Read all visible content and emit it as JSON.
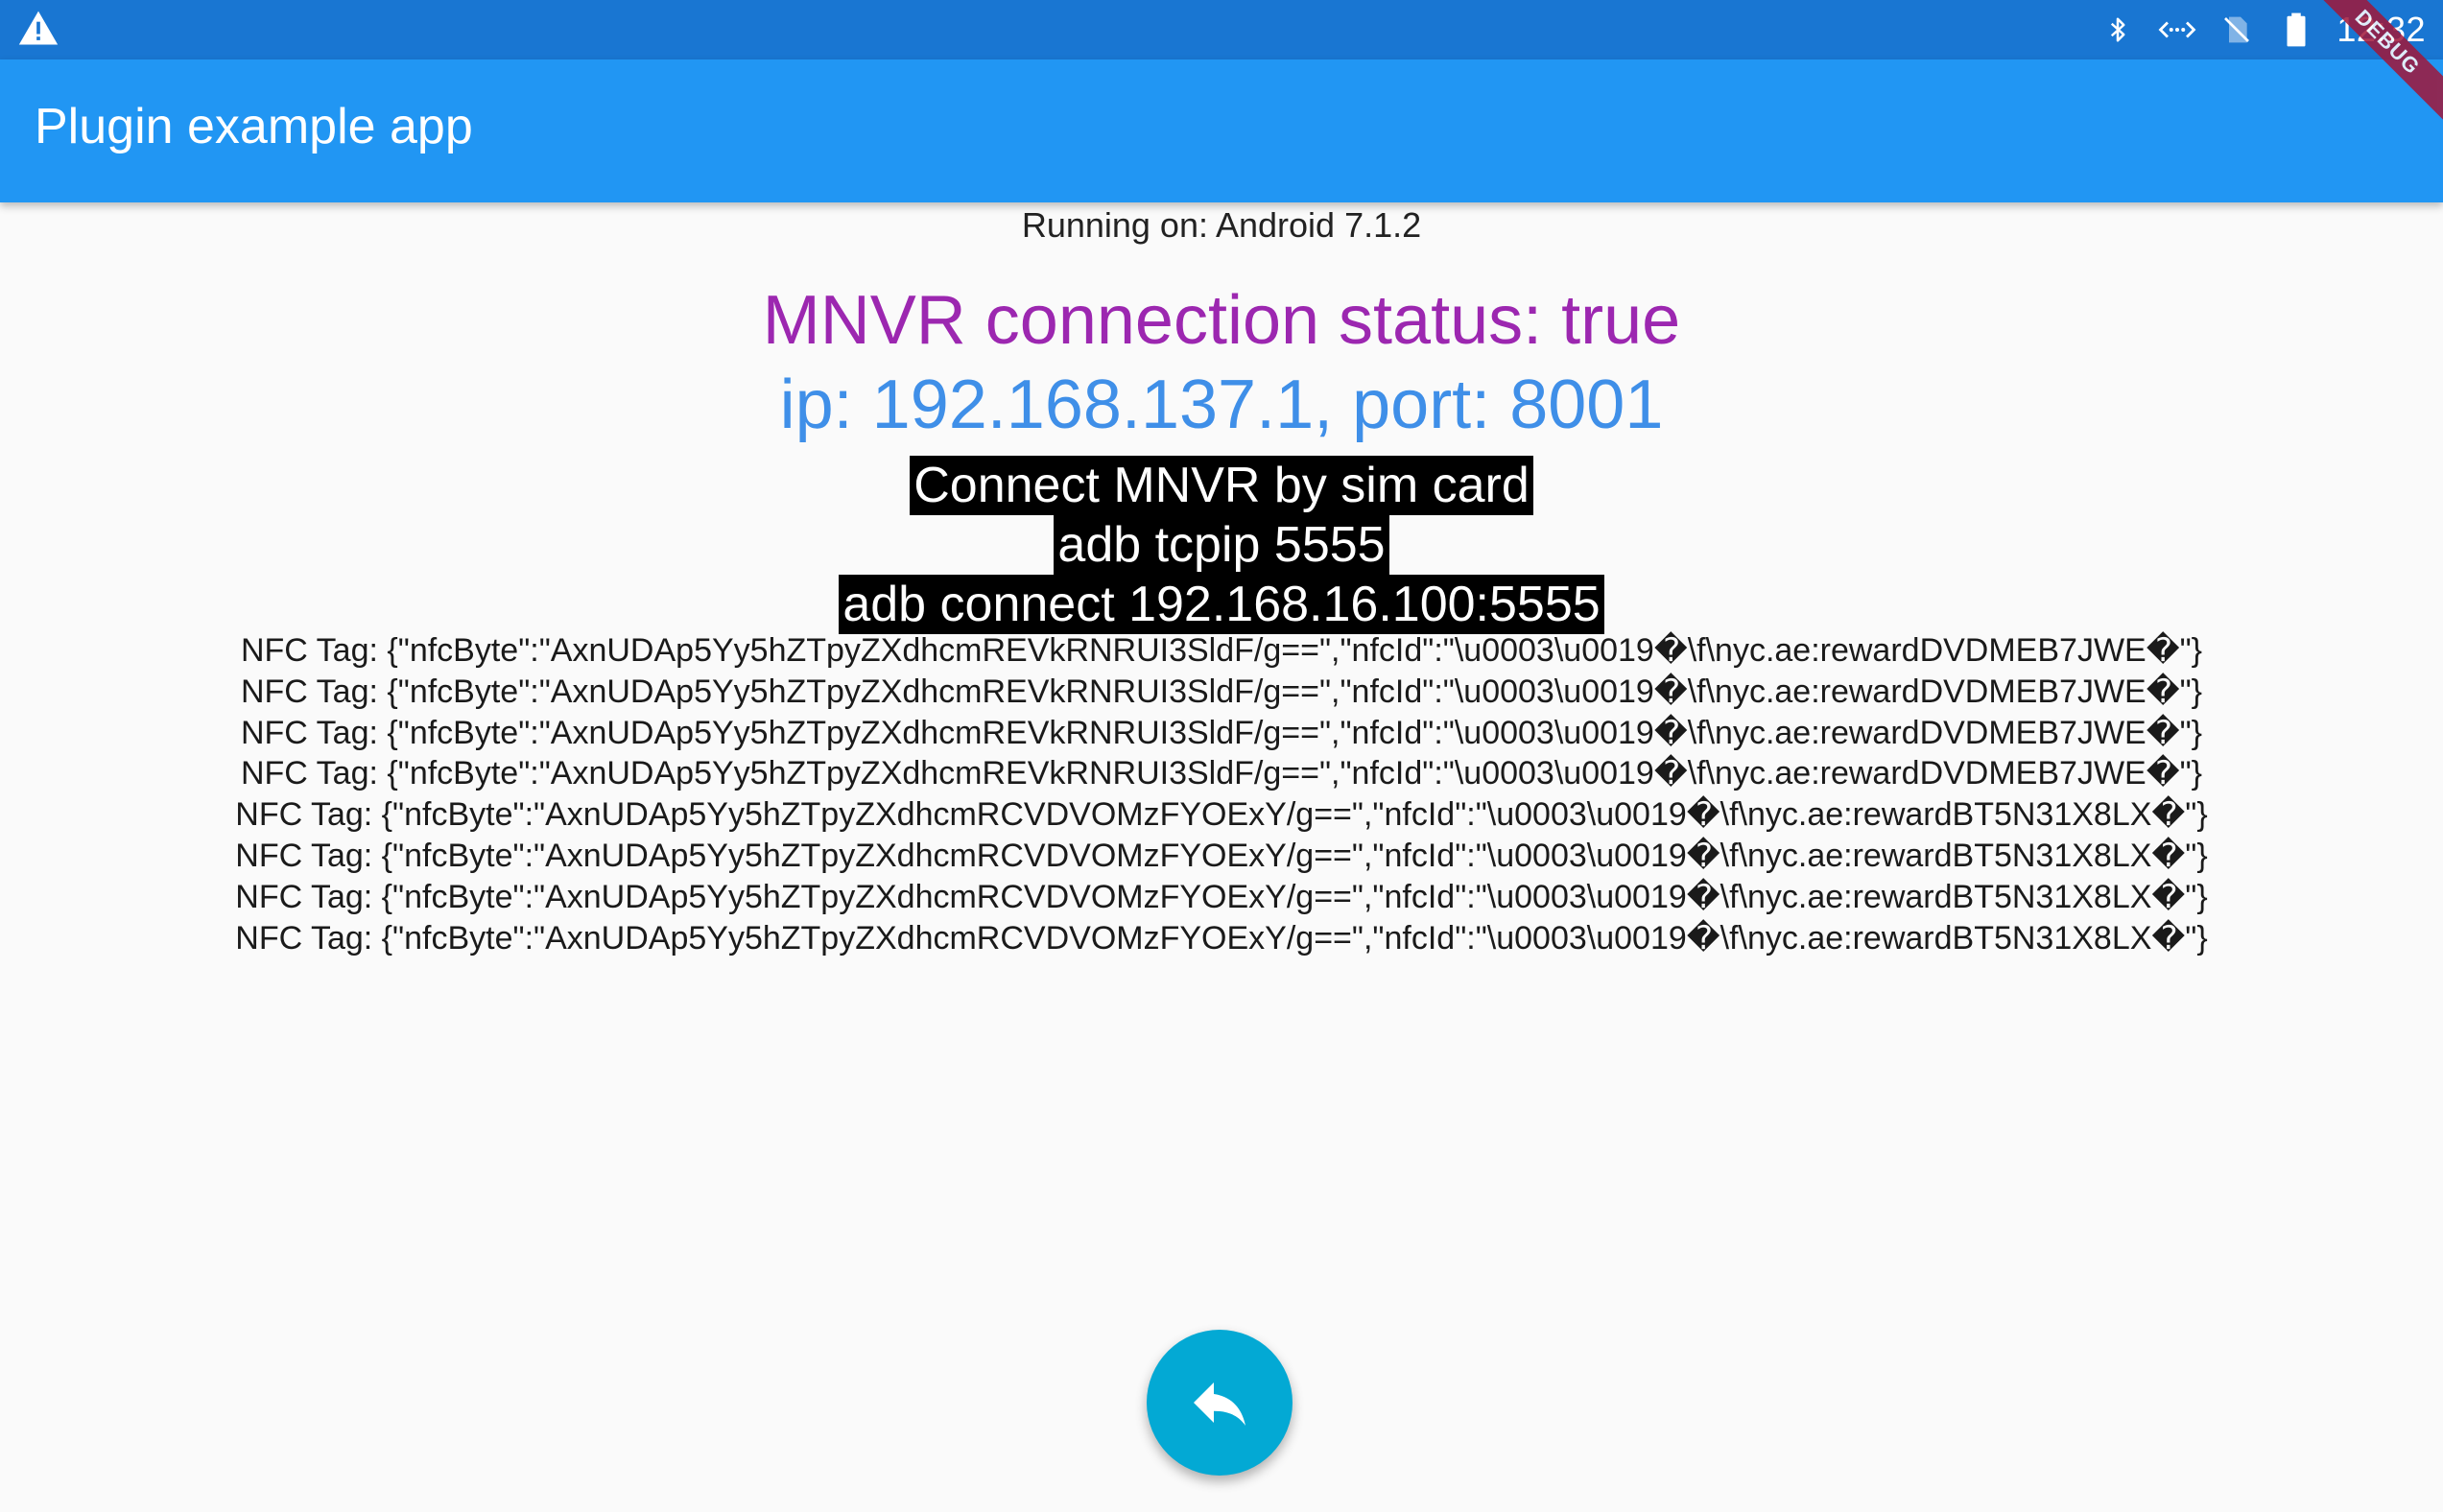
{
  "status_bar": {
    "time": "12:32",
    "left_icon": "warning-icon",
    "right_icons": [
      "bluetooth-icon",
      "data-transfer-icon",
      "no-sim-icon",
      "battery-icon"
    ]
  },
  "debug_banner": {
    "label": "DEBUG"
  },
  "app_bar": {
    "title": "Plugin example app"
  },
  "main": {
    "running_on": "Running on: Android 7.1.2",
    "mnvr_status": "MNVR connection status: true",
    "ip_port": "ip: 192.168.137.1, port: 8001",
    "instructions": [
      "Connect MNVR by sim card",
      "adb tcpip 5555",
      "adb connect 192.168.16.100:5555"
    ],
    "nfc_tags": [
      "NFC Tag: {\"nfcByte\":\"AxnUDAp5Yy5hZTpyZXdhcmREVkRNRUI3SldF/g==\",\"nfcId\":\"\\u0003\\u0019�\\f\\nyc.ae:rewardDVDMEB7JWE�\"}",
      "NFC Tag: {\"nfcByte\":\"AxnUDAp5Yy5hZTpyZXdhcmREVkRNRUI3SldF/g==\",\"nfcId\":\"\\u0003\\u0019�\\f\\nyc.ae:rewardDVDMEB7JWE�\"}",
      "NFC Tag: {\"nfcByte\":\"AxnUDAp5Yy5hZTpyZXdhcmREVkRNRUI3SldF/g==\",\"nfcId\":\"\\u0003\\u0019�\\f\\nyc.ae:rewardDVDMEB7JWE�\"}",
      "NFC Tag: {\"nfcByte\":\"AxnUDAp5Yy5hZTpyZXdhcmREVkRNRUI3SldF/g==\",\"nfcId\":\"\\u0003\\u0019�\\f\\nyc.ae:rewardDVDMEB7JWE�\"}",
      "NFC Tag: {\"nfcByte\":\"AxnUDAp5Yy5hZTpyZXdhcmRCVDVOMzFYOExY/g==\",\"nfcId\":\"\\u0003\\u0019�\\f\\nyc.ae:rewardBT5N31X8LX�\"}",
      "NFC Tag: {\"nfcByte\":\"AxnUDAp5Yy5hZTpyZXdhcmRCVDVOMzFYOExY/g==\",\"nfcId\":\"\\u0003\\u0019�\\f\\nyc.ae:rewardBT5N31X8LX�\"}",
      "NFC Tag: {\"nfcByte\":\"AxnUDAp5Yy5hZTpyZXdhcmRCVDVOMzFYOExY/g==\",\"nfcId\":\"\\u0003\\u0019�\\f\\nyc.ae:rewardBT5N31X8LX�\"}",
      "NFC Tag: {\"nfcByte\":\"AxnUDAp5Yy5hZTpyZXdhcmRCVDVOMzFYOExY/g==\",\"nfcId\":\"\\u0003\\u0019�\\f\\nyc.ae:rewardBT5N31X8LX�\"}"
    ]
  },
  "fab": {
    "icon": "reply-icon"
  },
  "colors": {
    "status_bar": "#1976d2",
    "app_bar": "#2196f3",
    "mnvr_status": "#9c27b0",
    "ip_port": "#3f8fe8",
    "fab": "#03a9d4",
    "debug_ribbon": "#a0173a"
  }
}
